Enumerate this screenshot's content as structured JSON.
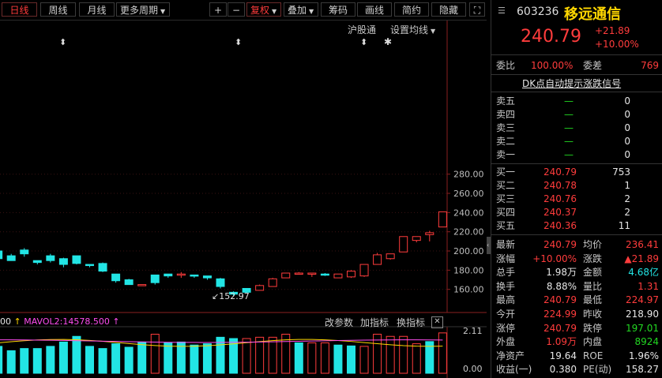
{
  "toolbar": {
    "day": "日线",
    "week": "周线",
    "month": "月线",
    "more_periods": "更多周期",
    "plus": "+",
    "minus": "−",
    "fuquan": "复权",
    "overlay": "叠加",
    "chips": "筹码",
    "draw": "画线",
    "simple": "简约",
    "hide": "隐藏"
  },
  "chart_header": {
    "index": "沪股通",
    "ma_settings": "设置均线"
  },
  "chart_data": {
    "type": "candlestick",
    "y_ticks": [
      "280.00",
      "260.00",
      "240.00",
      "220.00",
      "200.00",
      "180.00",
      "160.00"
    ],
    "y_values": [
      280,
      260,
      240,
      220,
      200,
      180,
      160
    ],
    "low_annotation": "152.97",
    "candles": [
      [
        -1,
        205,
        195,
        200,
        192
      ],
      [
        0,
        197,
        190,
        195,
        190
      ],
      [
        1,
        203,
        194,
        201,
        197
      ],
      [
        2,
        190,
        186,
        190,
        188
      ],
      [
        3,
        197,
        188,
        195,
        190
      ],
      [
        4,
        193,
        183,
        192,
        186
      ],
      [
        5,
        195,
        186,
        195,
        187
      ],
      [
        6,
        186,
        183,
        186,
        185
      ],
      [
        7,
        188,
        178,
        187,
        179
      ],
      [
        8,
        176,
        167,
        176,
        169
      ],
      [
        9,
        171,
        165,
        170,
        165
      ],
      [
        10,
        165,
        165,
        165,
        165
      ],
      [
        11,
        175,
        165,
        175,
        167
      ],
      [
        12,
        176,
        172,
        176,
        174
      ],
      [
        13,
        178,
        172,
        176,
        176
      ],
      [
        14,
        175,
        172,
        175,
        174
      ],
      [
        15,
        174,
        170,
        174,
        172
      ],
      [
        16,
        172,
        161,
        171,
        163
      ],
      [
        17,
        158,
        153,
        157,
        155
      ],
      [
        18,
        161,
        156,
        161,
        157
      ],
      [
        19,
        165,
        159,
        159,
        164
      ],
      [
        20,
        172,
        163,
        163,
        171
      ],
      [
        21,
        177,
        172,
        172,
        177
      ],
      [
        22,
        178,
        176,
        177,
        177
      ],
      [
        23,
        177,
        173,
        177,
        177
      ],
      [
        24,
        177,
        174,
        176,
        175
      ],
      [
        25,
        176,
        172,
        172,
        176
      ],
      [
        26,
        180,
        172,
        173,
        179
      ],
      [
        27,
        186,
        173,
        174,
        186
      ],
      [
        28,
        198,
        186,
        186,
        196
      ],
      [
        29,
        197,
        191,
        192,
        197
      ],
      [
        30,
        215,
        199,
        199,
        215
      ],
      [
        31,
        215,
        209,
        211,
        215
      ],
      [
        32,
        221,
        210,
        217,
        219
      ],
      [
        33,
        240.79,
        224.97,
        224.99,
        240.79
      ]
    ]
  },
  "volume": {
    "left_label": "00",
    "mavol2": "MAVOL2:14578.500",
    "y_top": "2.11",
    "y_bottom": "0.00",
    "btn_params": "改参数",
    "btn_add_indicator": "加指标",
    "btn_switch_indicator": "换指标",
    "bars": [
      [
        -1,
        0.62,
        0
      ],
      [
        0,
        0.52,
        0
      ],
      [
        1,
        0.57,
        0
      ],
      [
        2,
        0.57,
        0
      ],
      [
        3,
        0.62,
        0
      ],
      [
        4,
        0.72,
        0
      ],
      [
        5,
        0.85,
        0
      ],
      [
        6,
        0.62,
        0
      ],
      [
        7,
        0.57,
        0
      ],
      [
        8,
        0.68,
        0
      ],
      [
        9,
        0.6,
        0
      ],
      [
        10,
        0.72,
        0
      ],
      [
        11,
        0.9,
        1
      ],
      [
        12,
        0.7,
        0
      ],
      [
        13,
        0.72,
        0
      ],
      [
        14,
        0.65,
        0
      ],
      [
        15,
        0.68,
        0
      ],
      [
        16,
        0.83,
        0
      ],
      [
        17,
        0.8,
        0
      ],
      [
        18,
        0.8,
        1
      ],
      [
        19,
        0.83,
        1
      ],
      [
        20,
        0.83,
        1
      ],
      [
        21,
        0.9,
        1
      ],
      [
        22,
        0.7,
        0
      ],
      [
        23,
        0.7,
        1
      ],
      [
        24,
        0.7,
        1
      ],
      [
        25,
        0.65,
        0
      ],
      [
        26,
        0.63,
        0
      ],
      [
        27,
        0.62,
        1
      ],
      [
        28,
        0.9,
        1
      ],
      [
        29,
        0.85,
        1
      ],
      [
        30,
        0.85,
        1
      ],
      [
        31,
        0.68,
        1
      ],
      [
        32,
        0.73,
        0
      ],
      [
        33,
        0.93,
        1
      ]
    ]
  },
  "stock": {
    "code": "603236",
    "name": "移远通信",
    "price": "240.79",
    "change": "+21.89",
    "pct": "+10.00%"
  },
  "ratio": {
    "wb_label": "委比",
    "wb_value": "100.00%",
    "wc_label": "委差",
    "wc_value": "769"
  },
  "dk_link": "DK点自动提示涨跌信号",
  "order_book": {
    "asks": [
      {
        "label": "卖五",
        "price": "—",
        "vol": "0"
      },
      {
        "label": "卖四",
        "price": "—",
        "vol": "0"
      },
      {
        "label": "卖三",
        "price": "—",
        "vol": "0"
      },
      {
        "label": "卖二",
        "price": "—",
        "vol": "0"
      },
      {
        "label": "卖一",
        "price": "—",
        "vol": "0"
      }
    ],
    "bids": [
      {
        "label": "买一",
        "price": "240.79",
        "vol": "753"
      },
      {
        "label": "买二",
        "price": "240.78",
        "vol": "1"
      },
      {
        "label": "买三",
        "price": "240.76",
        "vol": "2"
      },
      {
        "label": "买四",
        "price": "240.37",
        "vol": "2"
      },
      {
        "label": "买五",
        "price": "240.36",
        "vol": "11"
      }
    ]
  },
  "quote": [
    {
      "l1": "最新",
      "v1": "240.79",
      "c1": "red",
      "l2": "均价",
      "v2": "236.41",
      "c2": "red"
    },
    {
      "l1": "涨幅",
      "v1": "+10.00%",
      "c1": "red",
      "l2": "涨跌",
      "v2": "▲21.89",
      "c2": "red"
    },
    {
      "l1": "总手",
      "v1": "1.98万",
      "c1": "white",
      "l2": "金额",
      "v2": "4.68亿",
      "c2": "cyan"
    },
    {
      "l1": "换手",
      "v1": "8.88%",
      "c1": "white",
      "l2": "量比",
      "v2": "1.31",
      "c2": "red"
    },
    {
      "l1": "最高",
      "v1": "240.79",
      "c1": "red",
      "l2": "最低",
      "v2": "224.97",
      "c2": "red"
    },
    {
      "l1": "今开",
      "v1": "224.99",
      "c1": "red",
      "l2": "昨收",
      "v2": "218.90",
      "c2": "white"
    },
    {
      "l1": "涨停",
      "v1": "240.79",
      "c1": "red",
      "l2": "跌停",
      "v2": "197.01",
      "c2": "green"
    },
    {
      "l1": "外盘",
      "v1": "1.09万",
      "c1": "red",
      "l2": "内盘",
      "v2": "8924",
      "c2": "green"
    },
    {
      "l1": "净资产",
      "v1": "19.64",
      "c1": "white",
      "l2": "ROE",
      "v2": "1.96%",
      "c2": "white"
    },
    {
      "l1": "收益(一)",
      "v1": "0.380",
      "c1": "white",
      "l2": "PE(动)",
      "v2": "158.27",
      "c2": "white"
    }
  ],
  "colors": {
    "up": "#ff3c3c",
    "down": "#22e5e5",
    "accent_yellow": "#ffd700"
  }
}
